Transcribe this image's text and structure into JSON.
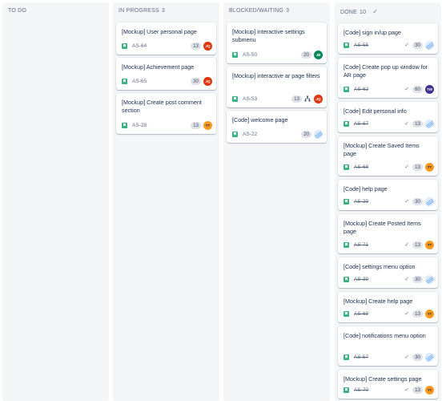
{
  "colors": {
    "column_bg": "#f4f5f7",
    "story_green": "#36b37e",
    "avatar_jq": "#de350b",
    "avatar_jb": "#00875a",
    "avatar_tm": "#403294",
    "avatar_tt": "#ff991f"
  },
  "columns": [
    {
      "title": "TO DO",
      "count": ""
    },
    {
      "title": "IN PROGRESS",
      "count": "3"
    },
    {
      "title": "BLOCKED/WAITING",
      "count": "3"
    },
    {
      "title": "DONE",
      "count": "10"
    }
  ],
  "in_progress": [
    {
      "title": "[Mockup] User personal page",
      "key": "AS-64",
      "points": "13",
      "assignee": "JQ"
    },
    {
      "title": "[Mockup] Achievement page",
      "key": "AS-65",
      "points": "30",
      "assignee": "JQ"
    },
    {
      "title": "[Mockup] Create post comment section",
      "key": "AS-28",
      "points": "13",
      "assignee": "TT"
    }
  ],
  "blocked": [
    {
      "title": "[Mockup] interactive settings submenu",
      "key": "AS-50",
      "points": "20",
      "assignee": "JB"
    },
    {
      "title": "[Mockup] interactive ar page filters",
      "key": "AS-53",
      "points": "13",
      "assignee": "JQ",
      "icon": "subtask-icon"
    },
    {
      "title": "[Code] welcome page",
      "key": "AS-22",
      "points": "20",
      "assignee": ""
    }
  ],
  "done": [
    {
      "title": "[Code] sign in/up page",
      "key": "AS-55",
      "points": "30",
      "assignee": ""
    },
    {
      "title": "[Code] Create pop up window for AR page",
      "key": "AS-62",
      "points": "60",
      "assignee": "TM"
    },
    {
      "title": "[Code] Edit personal info",
      "key": "AS-67",
      "points": "13",
      "assignee": ""
    },
    {
      "title": "[Mockup] Create Saved Items page",
      "key": "AS-68",
      "points": "13",
      "assignee": "TT"
    },
    {
      "title": "[Code] help page",
      "key": "AS-29",
      "points": "30",
      "assignee": ""
    },
    {
      "title": "[Mockup] Create Posted Items page",
      "key": "AS-71",
      "points": "13",
      "assignee": "TT"
    },
    {
      "title": "[Code] settings menu option",
      "key": "AS-39",
      "points": "30",
      "assignee": ""
    },
    {
      "title": "[Mockup] Create help page",
      "key": "AS-69",
      "points": "13",
      "assignee": "TT"
    },
    {
      "title": "[Code] notifications menu option",
      "key": "AS-57",
      "points": "30",
      "assignee": ""
    },
    {
      "title": "[Mockup] Create settings page",
      "key": "AS-70",
      "points": "13",
      "assignee": "TT"
    }
  ]
}
